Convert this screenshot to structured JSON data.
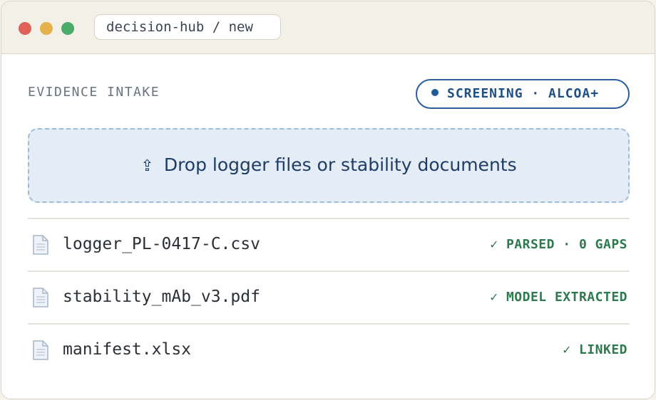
{
  "window": {
    "address": "decision-hub / new"
  },
  "intake": {
    "label": "EVIDENCE INTAKE",
    "badge": "SCREENING · ALCOA+",
    "dropzone": {
      "icon": "⇪",
      "text": "Drop logger files or stability documents"
    }
  },
  "files": [
    {
      "name": "logger_PL-0417-C.csv",
      "status": "✓ PARSED · 0 GAPS",
      "icon": "file-icon"
    },
    {
      "name": "stability_mAb_v3.pdf",
      "status": "✓ MODEL EXTRACTED",
      "icon": "file-icon"
    },
    {
      "name": "manifest.xlsx",
      "status": "✓ LINKED",
      "icon": "file-icon"
    }
  ],
  "colors": {
    "accent": "#2a5f9e",
    "success": "#2d7a4e",
    "dropzone_bg": "#e4edf6"
  }
}
